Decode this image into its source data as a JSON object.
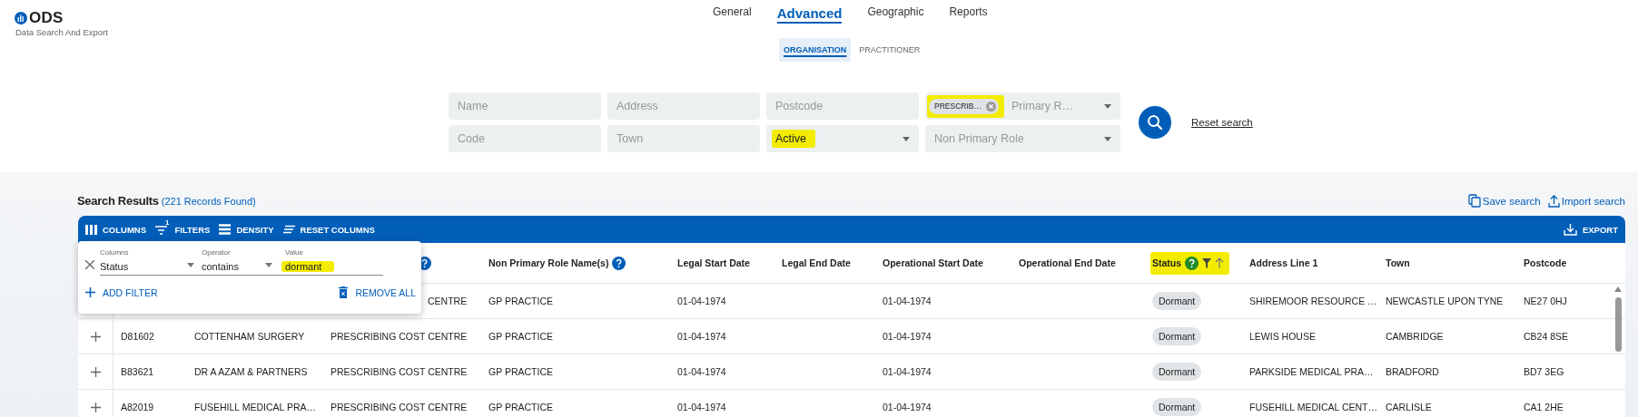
{
  "brand": {
    "name": "ODS",
    "tagline": "Data Search And Export"
  },
  "nav_tabs": [
    {
      "label": "General",
      "selected": false
    },
    {
      "label": "Advanced",
      "selected": true
    },
    {
      "label": "Geographic",
      "selected": false
    },
    {
      "label": "Reports",
      "selected": false
    }
  ],
  "sub_tabs": [
    {
      "label": "ORGANISATION",
      "selected": true
    },
    {
      "label": "PRACTITIONER",
      "selected": false
    }
  ],
  "search_fields": [
    {
      "kind": "text",
      "placeholder": "Name"
    },
    {
      "kind": "text",
      "placeholder": "Address"
    },
    {
      "kind": "text",
      "placeholder": "Postcode"
    },
    {
      "kind": "chip-select",
      "chip": "PRESCRIB…",
      "placeholder": "Primary R…",
      "highlighted": true
    },
    {
      "kind": "text",
      "placeholder": "Code"
    },
    {
      "kind": "text",
      "placeholder": "Town"
    },
    {
      "kind": "select",
      "value": "Active",
      "highlighted": true
    },
    {
      "kind": "select",
      "placeholder": "Non Primary Role",
      "highlighted": false
    }
  ],
  "reset_link": "Reset search",
  "results": {
    "title": "Search Results",
    "count": "(221 Records Found)",
    "actions": [
      {
        "kind": "save",
        "label": "Save search"
      },
      {
        "kind": "import",
        "label": "Import search"
      }
    ]
  },
  "toolbar": {
    "items": [
      {
        "kind": "columns",
        "label": "COLUMNS"
      },
      {
        "kind": "filters",
        "label": "FILTERS",
        "badge": "1"
      },
      {
        "kind": "density",
        "label": "DENSITY"
      },
      {
        "kind": "reset",
        "label": "RESET COLUMNS"
      }
    ],
    "export": "EXPORT"
  },
  "filter_panel": {
    "column_label": "Columns",
    "column_value": "Status",
    "operator_label": "Operator",
    "operator_value": "contains",
    "value_label": "Value",
    "value": "dormant",
    "value_highlighted": true,
    "add": "ADD FILTER",
    "remove": "REMOVE ALL"
  },
  "table": {
    "columns": [
      {},
      {},
      {
        "help": true
      },
      {
        "label": "Non Primary Role Name(s)",
        "help": true
      },
      {
        "label": "Legal Start Date"
      },
      {
        "label": "Legal End Date"
      },
      {
        "label": "Operational Start Date"
      },
      {
        "label": "Operational End Date"
      },
      {
        "label": "Status",
        "kind": "chip",
        "help": true,
        "filtered": true,
        "sort_ascending": true,
        "highlighted": true
      },
      {
        "label": "Address Line 1"
      },
      {
        "label": "Town"
      },
      {
        "label": "Postcode"
      }
    ],
    "rows": [
      {
        "covered": true,
        "cells": [
          null,
          null,
          "CENTRE",
          "GP PRACTICE",
          "01-04-1974",
          null,
          "01-04-1974",
          null,
          "Dormant",
          "SHIREMOOR RESOURCE …",
          "NEWCASTLE UPON TYNE",
          "NE27 0HJ"
        ]
      },
      {
        "covered": false,
        "cells": [
          "D81602",
          "COTTENHAM SURGERY",
          "PRESCRIBING COST CENTRE",
          "GP PRACTICE",
          "01-04-1974",
          null,
          "01-04-1974",
          null,
          "Dormant",
          "LEWIS HOUSE",
          "CAMBRIDGE",
          "CB24 8SE"
        ]
      },
      {
        "covered": false,
        "cells": [
          "B83621",
          "DR A AZAM & PARTNERS",
          "PRESCRIBING COST CENTRE",
          "GP PRACTICE",
          "01-04-1974",
          null,
          "01-04-1974",
          null,
          "Dormant",
          "PARKSIDE MEDICAL PRA…",
          "BRADFORD",
          "BD7 3EG"
        ]
      },
      {
        "covered": false,
        "cells": [
          "A82019",
          "FUSEHILL MEDICAL PRA…",
          "PRESCRIBING COST CENTRE",
          "GP PRACTICE",
          "01-04-1974",
          null,
          "01-04-1974",
          null,
          "Dormant",
          "FUSEHILL MEDICAL CENT…",
          "CARLISLE",
          "CA1 2HE"
        ]
      }
    ]
  }
}
